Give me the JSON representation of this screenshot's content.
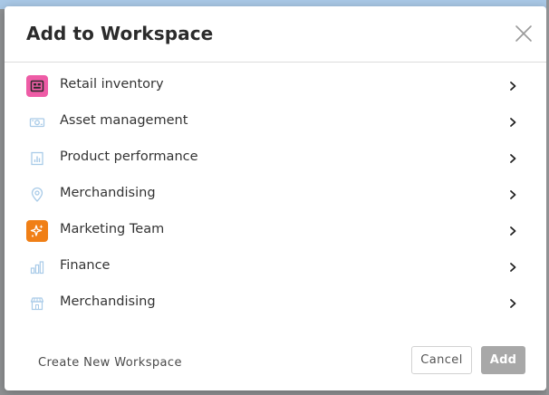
{
  "dialog": {
    "title": "Add to Workspace",
    "close_icon": "close-icon"
  },
  "workspaces": [
    {
      "label": "Retail inventory",
      "icon": "register-icon",
      "icon_bg": "#ee5ca6",
      "icon_fg": "#2a2a2a"
    },
    {
      "label": "Asset management",
      "icon": "money-icon",
      "icon_bg": "",
      "icon_fg": "#a9cbe8"
    },
    {
      "label": "Product performance",
      "icon": "bar-chart-icon",
      "icon_bg": "",
      "icon_fg": "#a9cbe8"
    },
    {
      "label": "Merchandising",
      "icon": "location-pin-icon",
      "icon_bg": "",
      "icon_fg": "#a9cbe8"
    },
    {
      "label": "Marketing Team",
      "icon": "sparkle-icon",
      "icon_bg": "#f07f16",
      "icon_fg": "#ffffff"
    },
    {
      "label": "Finance",
      "icon": "column-chart-icon",
      "icon_bg": "",
      "icon_fg": "#a9cbe8"
    },
    {
      "label": "Merchandising",
      "icon": "store-icon",
      "icon_bg": "",
      "icon_fg": "#a9cbe8"
    }
  ],
  "footer": {
    "create_label": "Create New Workspace",
    "cancel_label": "Cancel",
    "add_label": "Add"
  },
  "colors": {
    "add_button_disabled": "#a8a8a8",
    "chevron": "#222222"
  }
}
